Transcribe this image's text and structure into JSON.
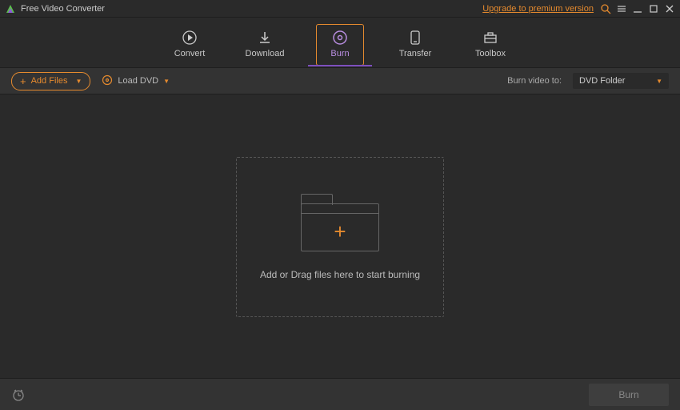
{
  "titlebar": {
    "title": "Free Video Converter",
    "upgrade": "Upgrade to premium version"
  },
  "tabs": {
    "convert": "Convert",
    "download": "Download",
    "burn": "Burn",
    "transfer": "Transfer",
    "toolbox": "Toolbox"
  },
  "toolbar": {
    "add_files": "Add Files",
    "load_dvd": "Load DVD",
    "burn_to_label": "Burn video to:",
    "burn_to_value": "DVD Folder"
  },
  "workspace": {
    "drop_text": "Add or Drag files here to start burning"
  },
  "footer": {
    "burn": "Burn"
  }
}
